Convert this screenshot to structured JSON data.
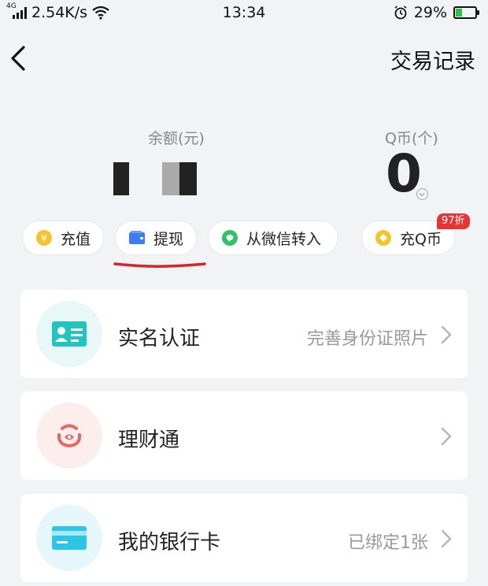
{
  "status_bar": {
    "network": "4G",
    "speed": "2.54K/s",
    "time": "13:34",
    "battery": "29%",
    "battery_fill": 0.29
  },
  "nav": {
    "action_label": "交易记录"
  },
  "balance": {
    "label": "余额(元)"
  },
  "qcoin": {
    "label": "Q币(个)",
    "value": "0"
  },
  "actions": {
    "recharge": "充值",
    "withdraw": "提现",
    "wechat_transfer": "从微信转入",
    "buy_qcoin": "充Q币",
    "discount": "97折"
  },
  "list": [
    {
      "title": "实名认证",
      "detail": "完善身份证照片",
      "icon": "id-card-icon"
    },
    {
      "title": "理财通",
      "detail": "",
      "icon": "wealth-icon"
    },
    {
      "title": "我的银行卡",
      "detail": "已绑定1张",
      "icon": "bank-card-icon"
    }
  ],
  "colors": {
    "background": "#f2f3f5",
    "teal": "#22c4c0",
    "red": "#e8665f",
    "cyan": "#2ec4e6",
    "wechat_green": "#2ec26a",
    "gold": "#f4c430",
    "blue": "#3d7cf0",
    "annotation_red": "#d3262a"
  }
}
